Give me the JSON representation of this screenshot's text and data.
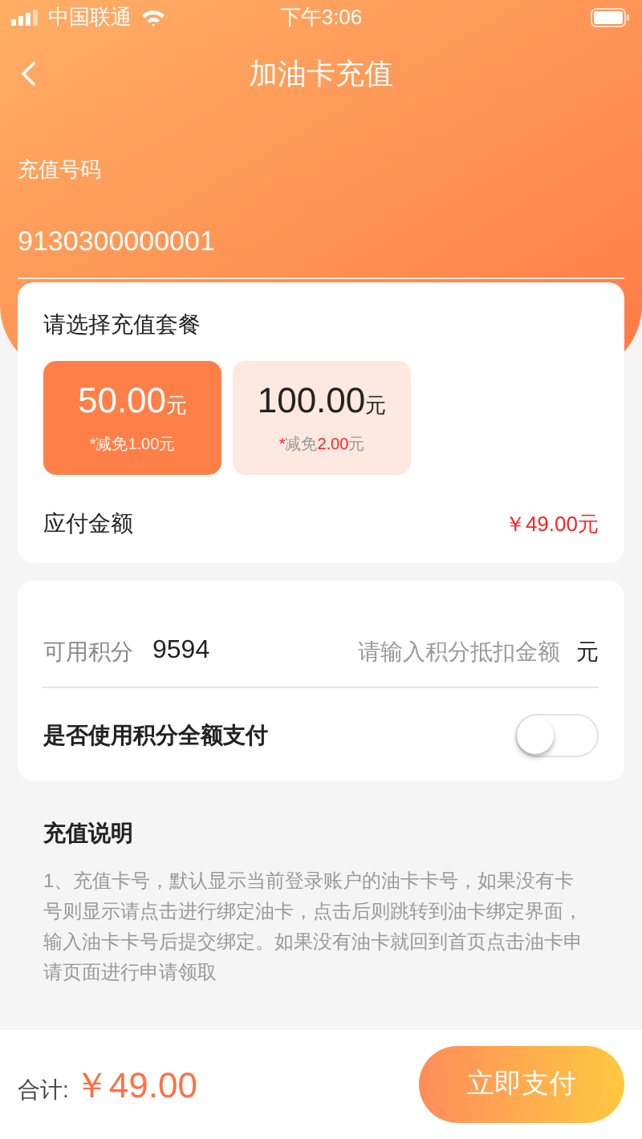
{
  "status_bar": {
    "carrier": "中国联通",
    "time": "下午3:06"
  },
  "nav": {
    "title": "加油卡充值"
  },
  "recharge_number": {
    "label": "充值号码",
    "value": "9130300000001"
  },
  "packages": {
    "title": "请选择充值套餐",
    "items": [
      {
        "amount": "50.00",
        "unit": "元",
        "note_mark": "*",
        "note_label": "减免",
        "note_amount": "1.00",
        "note_unit": "元",
        "selected": true
      },
      {
        "amount": "100.00",
        "unit": "元",
        "note_mark": "*",
        "note_label": "减免",
        "note_amount": "2.00",
        "note_unit": "元",
        "selected": false
      }
    ],
    "payable_label": "应付金额",
    "payable_value": "￥49.00元"
  },
  "points": {
    "label": "可用积分",
    "value": "9594",
    "placeholder": "请输入积分抵扣金额",
    "unit": "元",
    "full_pay_label": "是否使用积分全额支付",
    "full_pay_on": false
  },
  "notes": {
    "title": "充值说明",
    "text": "1、充值卡号，默认显示当前登录账户的油卡卡号，如果没有卡号则显示请点击进行绑定油卡，点击后则跳转到油卡绑定界面，输入油卡卡号后提交绑定。如果没有油卡就回到首页点击油卡申请页面进行申请领取"
  },
  "footer": {
    "total_label": "合计:",
    "total_value": "￥49.00",
    "pay_button": "立即支付"
  }
}
